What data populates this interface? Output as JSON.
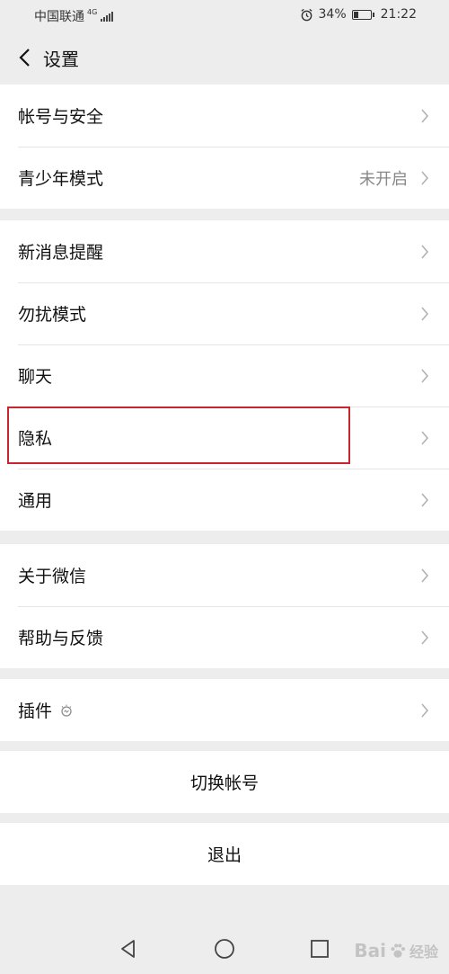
{
  "status": {
    "carrier": "中国联通",
    "network": "4G",
    "battery": "34%",
    "battery_level": 0.34,
    "time": "21:22"
  },
  "nav": {
    "title": "设置"
  },
  "groups": {
    "account": {
      "account_security": "帐号与安全",
      "teen_mode": "青少年模式",
      "teen_mode_value": "未开启"
    },
    "notify": {
      "new_message": "新消息提醒",
      "do_not_disturb": "勿扰模式",
      "chat": "聊天",
      "privacy": "隐私",
      "general": "通用"
    },
    "about": {
      "about_wechat": "关于微信",
      "help_feedback": "帮助与反馈"
    },
    "plugins": {
      "plugins": "插件"
    }
  },
  "actions": {
    "switch_account": "切换帐号",
    "logout": "退出"
  },
  "watermark": {
    "text": "Bai",
    "suffix": "经验"
  },
  "colors": {
    "highlight": "#c8262d",
    "background": "#ededed"
  }
}
